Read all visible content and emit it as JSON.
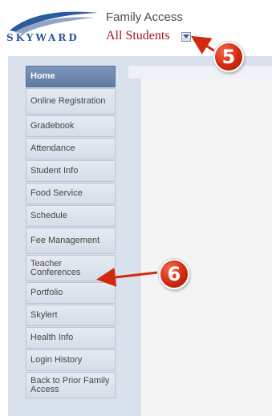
{
  "header": {
    "logo_text": "SKYWARD",
    "app_title": "Family Access",
    "student_selector": "All Students"
  },
  "sidebar": {
    "items": [
      {
        "label": "Home"
      },
      {
        "label": "Online Registration"
      },
      {
        "label": "Gradebook"
      },
      {
        "label": "Attendance"
      },
      {
        "label": "Student Info"
      },
      {
        "label": "Food Service"
      },
      {
        "label": "Schedule"
      },
      {
        "label": "Fee Management"
      },
      {
        "label": "Teacher Conferences"
      },
      {
        "label": "Portfolio"
      },
      {
        "label": "Skylert"
      },
      {
        "label": "Health Info"
      },
      {
        "label": "Login History"
      },
      {
        "label": "Back to Prior Family Access"
      }
    ]
  },
  "annotations": {
    "badge_5": "5",
    "badge_6": "6"
  },
  "colors": {
    "brand_blue": "#2b5b9a",
    "student_red": "#a3151e",
    "annotation_red": "#d12a10",
    "home_active": "#6d86ae"
  }
}
